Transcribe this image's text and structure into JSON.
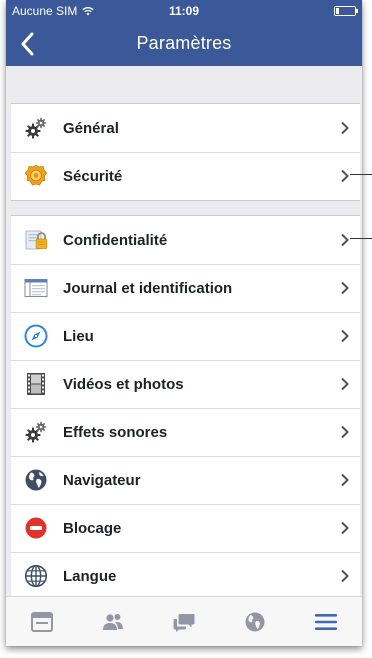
{
  "status": {
    "carrier": "Aucune SIM",
    "time": "11:09",
    "battery_level": 0.15
  },
  "nav": {
    "title": "Paramètres"
  },
  "groups": [
    {
      "items": [
        {
          "label": "Général",
          "icon": "gears-icon"
        },
        {
          "label": "Sécurité",
          "icon": "security-badge-icon"
        }
      ]
    },
    {
      "items": [
        {
          "label": "Confidentialité",
          "icon": "privacy-lock-icon"
        },
        {
          "label": "Journal et identification",
          "icon": "timeline-icon"
        },
        {
          "label": "Lieu",
          "icon": "compass-icon"
        },
        {
          "label": "Vidéos et photos",
          "icon": "film-icon"
        },
        {
          "label": "Effets sonores",
          "icon": "gears-icon"
        },
        {
          "label": "Navigateur",
          "icon": "globe-icon"
        },
        {
          "label": "Blocage",
          "icon": "block-icon"
        },
        {
          "label": "Langue",
          "icon": "language-globe-icon"
        }
      ]
    }
  ],
  "tabbar": {
    "items": [
      {
        "icon": "news-feed-icon",
        "active": false
      },
      {
        "icon": "friends-icon",
        "active": false
      },
      {
        "icon": "messages-icon",
        "active": false
      },
      {
        "icon": "notifications-globe-icon",
        "active": false
      },
      {
        "icon": "menu-icon",
        "active": true
      }
    ]
  },
  "colors": {
    "brand": "#3b5998",
    "active_tab": "#4267b2",
    "inactive_tab": "#9197a3"
  }
}
